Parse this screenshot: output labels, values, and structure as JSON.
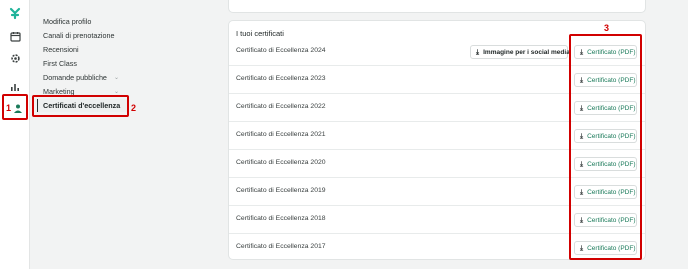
{
  "rail": {
    "icons": [
      "logo-icon",
      "calendar-icon",
      "gear-icon",
      "chart-icon",
      "profile-badge-icon"
    ]
  },
  "sidebar": {
    "items": [
      {
        "label": "Modifica profilo"
      },
      {
        "label": "Canali di prenotazione"
      },
      {
        "label": "Recensioni"
      },
      {
        "label": "First Class"
      },
      {
        "label": "Domande pubbliche",
        "chevron": "⌄"
      },
      {
        "label": "Marketing",
        "chevron": "⌄"
      },
      {
        "label": "Certificati d'eccellenza",
        "active": true
      }
    ]
  },
  "annotations": {
    "n1": "1",
    "n2": "2",
    "n3": "3",
    "color": "#d10000"
  },
  "certificates": {
    "title": "I tuoi certificati",
    "social_button": "Immagine per i social media",
    "pdf_button": "Certificato (PDF)",
    "rows": [
      {
        "label": "Certificato di Eccellenza 2024"
      },
      {
        "label": "Certificato di Eccellenza 2023"
      },
      {
        "label": "Certificato di Eccellenza 2022"
      },
      {
        "label": "Certificato di Eccellenza 2021"
      },
      {
        "label": "Certificato di Eccellenza 2020"
      },
      {
        "label": "Certificato di Eccellenza 2019"
      },
      {
        "label": "Certificato di Eccellenza 2018"
      },
      {
        "label": "Certificato di Eccellenza 2017"
      }
    ]
  },
  "colors": {
    "accent": "#1a7a5a",
    "logo": "#1fb39a",
    "annotation": "#d10000"
  }
}
